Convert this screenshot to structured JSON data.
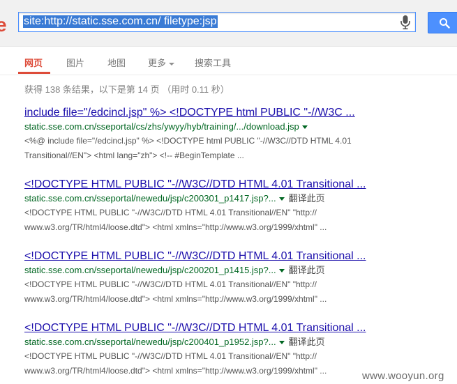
{
  "search": {
    "query": "site:http://static.sse.com.cn/ filetype:jsp",
    "logo_fragment": "e"
  },
  "icons": {
    "mic": "microphone-icon",
    "search": "search-icon"
  },
  "colors": {
    "brand_red": "#dd4b39",
    "link_blue": "#1a0dab",
    "url_green": "#006621",
    "button_blue": "#4d90fe"
  },
  "tabs": [
    {
      "label": "网页",
      "active": true
    },
    {
      "label": "图片"
    },
    {
      "label": "地图"
    },
    {
      "label": "更多"
    },
    {
      "label": "搜索工具"
    }
  ],
  "stats": "获得 138 条结果，以下是第 14 页 （用时 0.11 秒）",
  "results": [
    {
      "title": "include file=\"/edcincl.jsp\" %> <!DOCTYPE html PUBLIC \"-//W3C ...",
      "url": "static.sse.com.cn/sseportal/cs/zhs/ywyy/hyb/training/.../download.jsp",
      "translate": "",
      "snippet1": "<%@ include file=\"/edcincl.jsp\" %> <!DOCTYPE html PUBLIC \"-//W3C//DTD HTML 4.01",
      "snippet2": "Transitional//EN\"> <html lang=\"zh\"> <!-- #BeginTemplate ..."
    },
    {
      "title": "<!DOCTYPE HTML PUBLIC \"-//W3C//DTD HTML 4.01 Transitional ...",
      "url": "static.sse.com.cn/sseportal/newedu/jsp/c200301_p1417.jsp?...",
      "translate": "翻译此页",
      "snippet1": "<!DOCTYPE HTML PUBLIC \"-//W3C//DTD HTML 4.01 Transitional//EN\" \"http://",
      "snippet2": "www.w3.org/TR/html4/loose.dtd\"> <html xmlns=\"http://www.w3.org/1999/xhtml\" ..."
    },
    {
      "title": "<!DOCTYPE HTML PUBLIC \"-//W3C//DTD HTML 4.01 Transitional ...",
      "url": "static.sse.com.cn/sseportal/newedu/jsp/c200201_p1415.jsp?...",
      "translate": "翻译此页",
      "snippet1": "<!DOCTYPE HTML PUBLIC \"-//W3C//DTD HTML 4.01 Transitional//EN\" \"http://",
      "snippet2": "www.w3.org/TR/html4/loose.dtd\"> <html xmlns=\"http://www.w3.org/1999/xhtml\" ..."
    },
    {
      "title": "<!DOCTYPE HTML PUBLIC \"-//W3C//DTD HTML 4.01 Transitional ...",
      "url": "static.sse.com.cn/sseportal/newedu/jsp/c200401_p1952.jsp?...",
      "translate": "翻译此页",
      "snippet1": "<!DOCTYPE HTML PUBLIC \"-//W3C//DTD HTML 4.01 Transitional//EN\" \"http://",
      "snippet2": "www.w3.org/TR/html4/loose.dtd\"> <html xmlns=\"http://www.w3.org/1999/xhtml\" ..."
    }
  ],
  "watermark": "www.wooyun.org"
}
